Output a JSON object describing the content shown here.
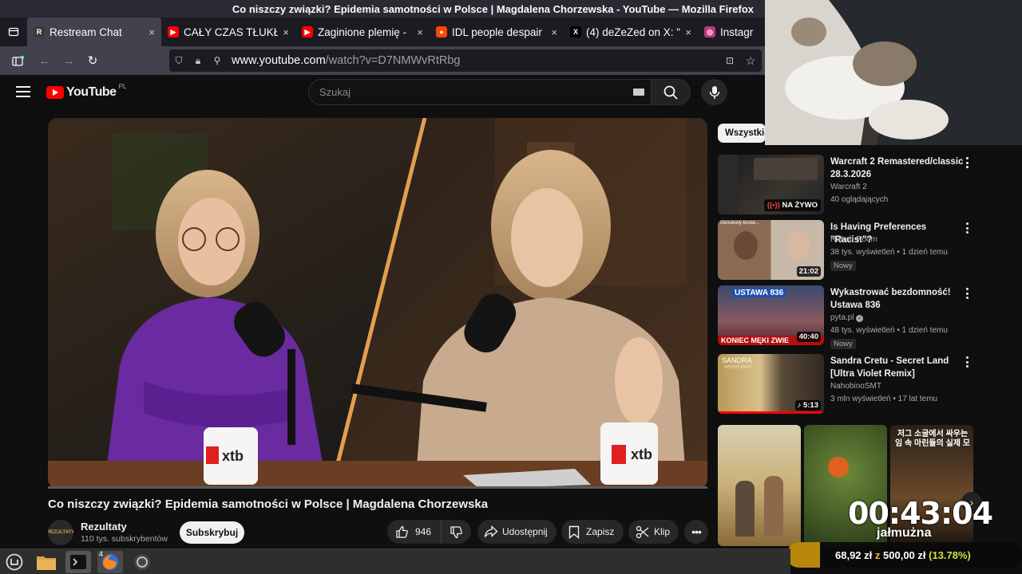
{
  "window": {
    "title": "Co niszczy związki? Epidemia samotności w Polsce | Magdalena Chorzewska - YouTube — Mozilla Firefox"
  },
  "tabs": [
    {
      "label": "Restream Chat",
      "icon": "restream-icon",
      "color": "#3a3a3a",
      "glyph": "R",
      "close": "×"
    },
    {
      "label": "CAŁY CZAS TŁUKŁO",
      "icon": "youtube-icon",
      "color": "#ff0000",
      "glyph": "▶",
      "close": "×"
    },
    {
      "label": "Zaginione plemię -",
      "icon": "youtube-icon",
      "color": "#ff0000",
      "glyph": "▶",
      "close": "×"
    },
    {
      "label": "IDL people despair",
      "icon": "reddit-icon",
      "color": "#ff4500",
      "glyph": "●",
      "close": "×"
    },
    {
      "label": "(4) deZeZed on X: \"",
      "icon": "x-icon",
      "color": "#000000",
      "glyph": "X",
      "close": "×"
    },
    {
      "label": "Instagra",
      "icon": "instagram-icon",
      "color": "#c13584",
      "glyph": "◎",
      "close": ""
    }
  ],
  "nav": {
    "url_host": "www.youtube.com",
    "url_path": "/watch?v=D7NMWvRtRbg"
  },
  "yt": {
    "logo_text": "YouTube",
    "country_code": "PL",
    "search_placeholder": "Szukaj"
  },
  "video": {
    "title": "Co niszczy związki? Epidemia samotności w Polsce | Magdalena Chorzewska",
    "channel": "Rezultaty",
    "channel_avatar_text": "REZULTATY",
    "subs": "110 tys. subskrybentów",
    "subscribe": "Subskrybuj",
    "likes": "946",
    "share": "Udostępnij",
    "save": "Zapisz",
    "clip": "Klip",
    "mug_brand": "xtb",
    "progress": 0.0
  },
  "sidebar": {
    "chip": "Wszystkie",
    "items": [
      {
        "title": "Warcraft 2 Remastered/classic 28.3.2026",
        "channel": "Warcraft 2",
        "meta": "40 oglądających",
        "badge": "NA ŻYWO",
        "duration": "",
        "new": ""
      },
      {
        "title": "Is Having Preferences \"Racist\"?",
        "channel": "Rehab Room",
        "meta": "38 tys. wyświetleń • 1 dzień temu",
        "badge": "",
        "duration": "21:02",
        "new": "Nowy",
        "thumb_caption": "Genuinely brutal..."
      },
      {
        "title": "Wykastrować bezdomność! Ustawa 836",
        "channel": "pyta.pl",
        "meta": "48 tys. wyświetleń • 1 dzień temu",
        "badge": "",
        "duration": "40:40",
        "new": "Nowy",
        "thumb_top": "USTAWA 836",
        "thumb_bottom": "KONIEC MĘKI ZWIE"
      },
      {
        "title": "Sandra Cretu - Secret Land [Ultra Violet Remix]",
        "channel": "NahobinoSMT",
        "meta": "3 mln wyświetleń • 17 lat temu",
        "badge": "",
        "duration": "♪ 5:13",
        "new": "",
        "thumb_top": "SANDRA",
        "thumb_sub": "secret land"
      }
    ],
    "shorts": [
      {
        "caption": ""
      },
      {
        "caption": ""
      },
      {
        "caption": "저그 소굴에서 싸우는 임 속 마린들의 실제 모"
      }
    ]
  },
  "overlay": {
    "timer": "00:43:04",
    "label": "jałmużna",
    "amount": "68,92 zł",
    "of": "z",
    "goal": "500,00 zł",
    "percent": "(13.78%)",
    "fraction": 0.1378
  }
}
